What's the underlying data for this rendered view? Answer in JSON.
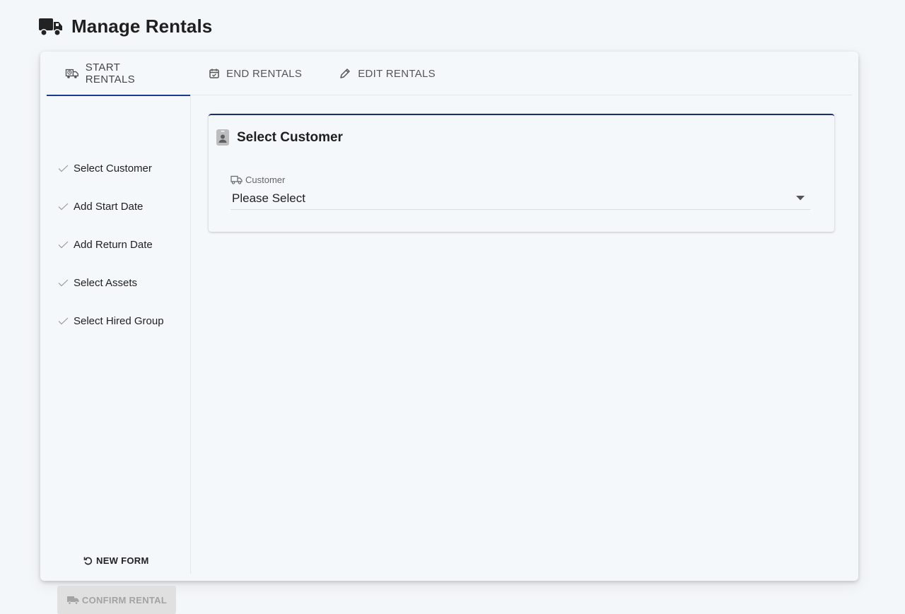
{
  "header": {
    "title": "Manage Rentals",
    "icon": "truck-icon"
  },
  "tabs": [
    {
      "label": "START RENTALS",
      "icon": "truck-clock-icon",
      "active": true
    },
    {
      "label": "END RENTALS",
      "icon": "calendar-check-icon",
      "active": false
    },
    {
      "label": "EDIT RENTALS",
      "icon": "pencil-icon",
      "active": false
    }
  ],
  "steps": [
    {
      "label": "Select Customer"
    },
    {
      "label": "Add Start Date"
    },
    {
      "label": "Add Return Date"
    },
    {
      "label": "Select Assets"
    },
    {
      "label": "Select Hired Group"
    }
  ],
  "actions": {
    "new_form_label": "NEW FORM",
    "confirm_label": "CONFIRM RENTAL"
  },
  "customer_section": {
    "title": "Select Customer",
    "field_label": "Customer",
    "field_value": "Please Select"
  },
  "colors": {
    "accent": "#1b3a8f",
    "card_top_border": "#1b2f6b",
    "disabled_button": "#e0e0e0"
  }
}
